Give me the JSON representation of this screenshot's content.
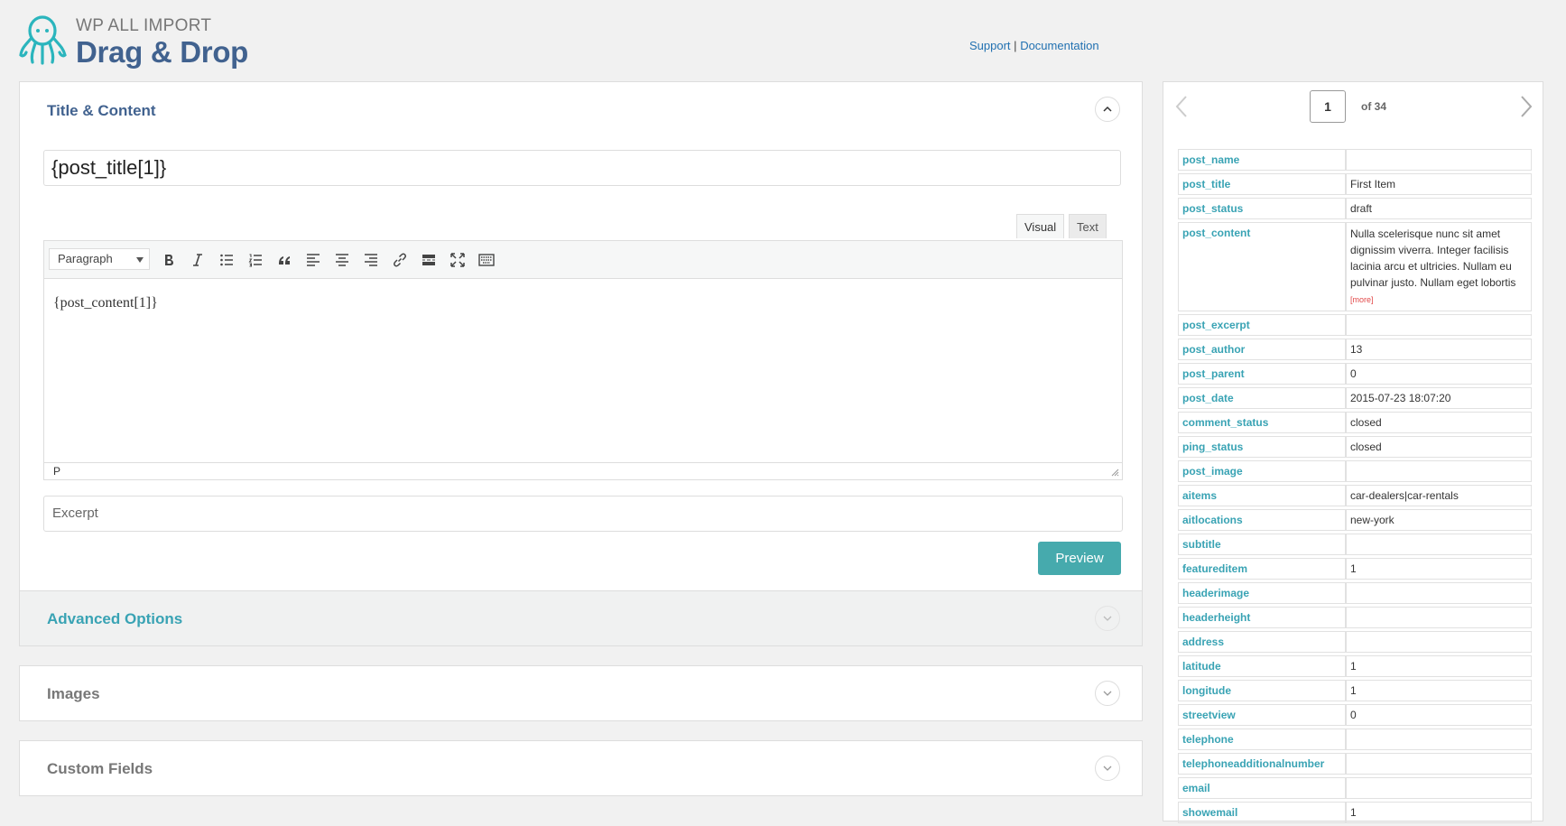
{
  "header": {
    "logo_small": "WP ALL IMPORT",
    "logo_big": "Drag & Drop",
    "support_link": "Support",
    "separator": "|",
    "documentation_link": "Documentation"
  },
  "title_content": {
    "heading": "Title & Content",
    "title_value": "{post_title[1]}",
    "tab_visual": "Visual",
    "tab_text": "Text",
    "format_select": "Paragraph",
    "content_value": "{post_content[1]}",
    "status_path": "P",
    "excerpt_placeholder": "Excerpt",
    "preview_button": "Preview"
  },
  "panels": {
    "advanced_options": "Advanced Options",
    "images": "Images",
    "custom_fields": "Custom Fields"
  },
  "colors": {
    "brand_blue": "#41628f",
    "teal": "#46aaad",
    "field_key": "#39a3b4",
    "link": "#2271b1"
  },
  "pager": {
    "current_page": "1",
    "of_label": "of 34"
  },
  "record": {
    "more_label": "[more]",
    "rows": [
      {
        "key": "post_name",
        "value": ""
      },
      {
        "key": "post_title",
        "value": "First Item"
      },
      {
        "key": "post_status",
        "value": "draft"
      },
      {
        "key": "post_content",
        "value": "Nulla scelerisque nunc sit amet dignissim viverra. Integer facilisis lacinia arcu et ultricies. Nullam eu pulvinar justo. Nullam eget lobortis"
      },
      {
        "key": "post_excerpt",
        "value": ""
      },
      {
        "key": "post_author",
        "value": "13"
      },
      {
        "key": "post_parent",
        "value": "0"
      },
      {
        "key": "post_date",
        "value": "2015-07-23 18:07:20"
      },
      {
        "key": "comment_status",
        "value": "closed"
      },
      {
        "key": "ping_status",
        "value": "closed"
      },
      {
        "key": "post_image",
        "value": ""
      },
      {
        "key": "aitems",
        "value": "car-dealers|car-rentals"
      },
      {
        "key": "aitlocations",
        "value": "new-york"
      },
      {
        "key": "subtitle",
        "value": ""
      },
      {
        "key": "featureditem",
        "value": "1"
      },
      {
        "key": "headerimage",
        "value": ""
      },
      {
        "key": "headerheight",
        "value": ""
      },
      {
        "key": "address",
        "value": ""
      },
      {
        "key": "latitude",
        "value": "1"
      },
      {
        "key": "longitude",
        "value": "1"
      },
      {
        "key": "streetview",
        "value": "0"
      },
      {
        "key": "telephone",
        "value": ""
      },
      {
        "key": "telephoneadditionalnumber",
        "value": ""
      },
      {
        "key": "email",
        "value": ""
      },
      {
        "key": "showemail",
        "value": "1"
      }
    ]
  }
}
